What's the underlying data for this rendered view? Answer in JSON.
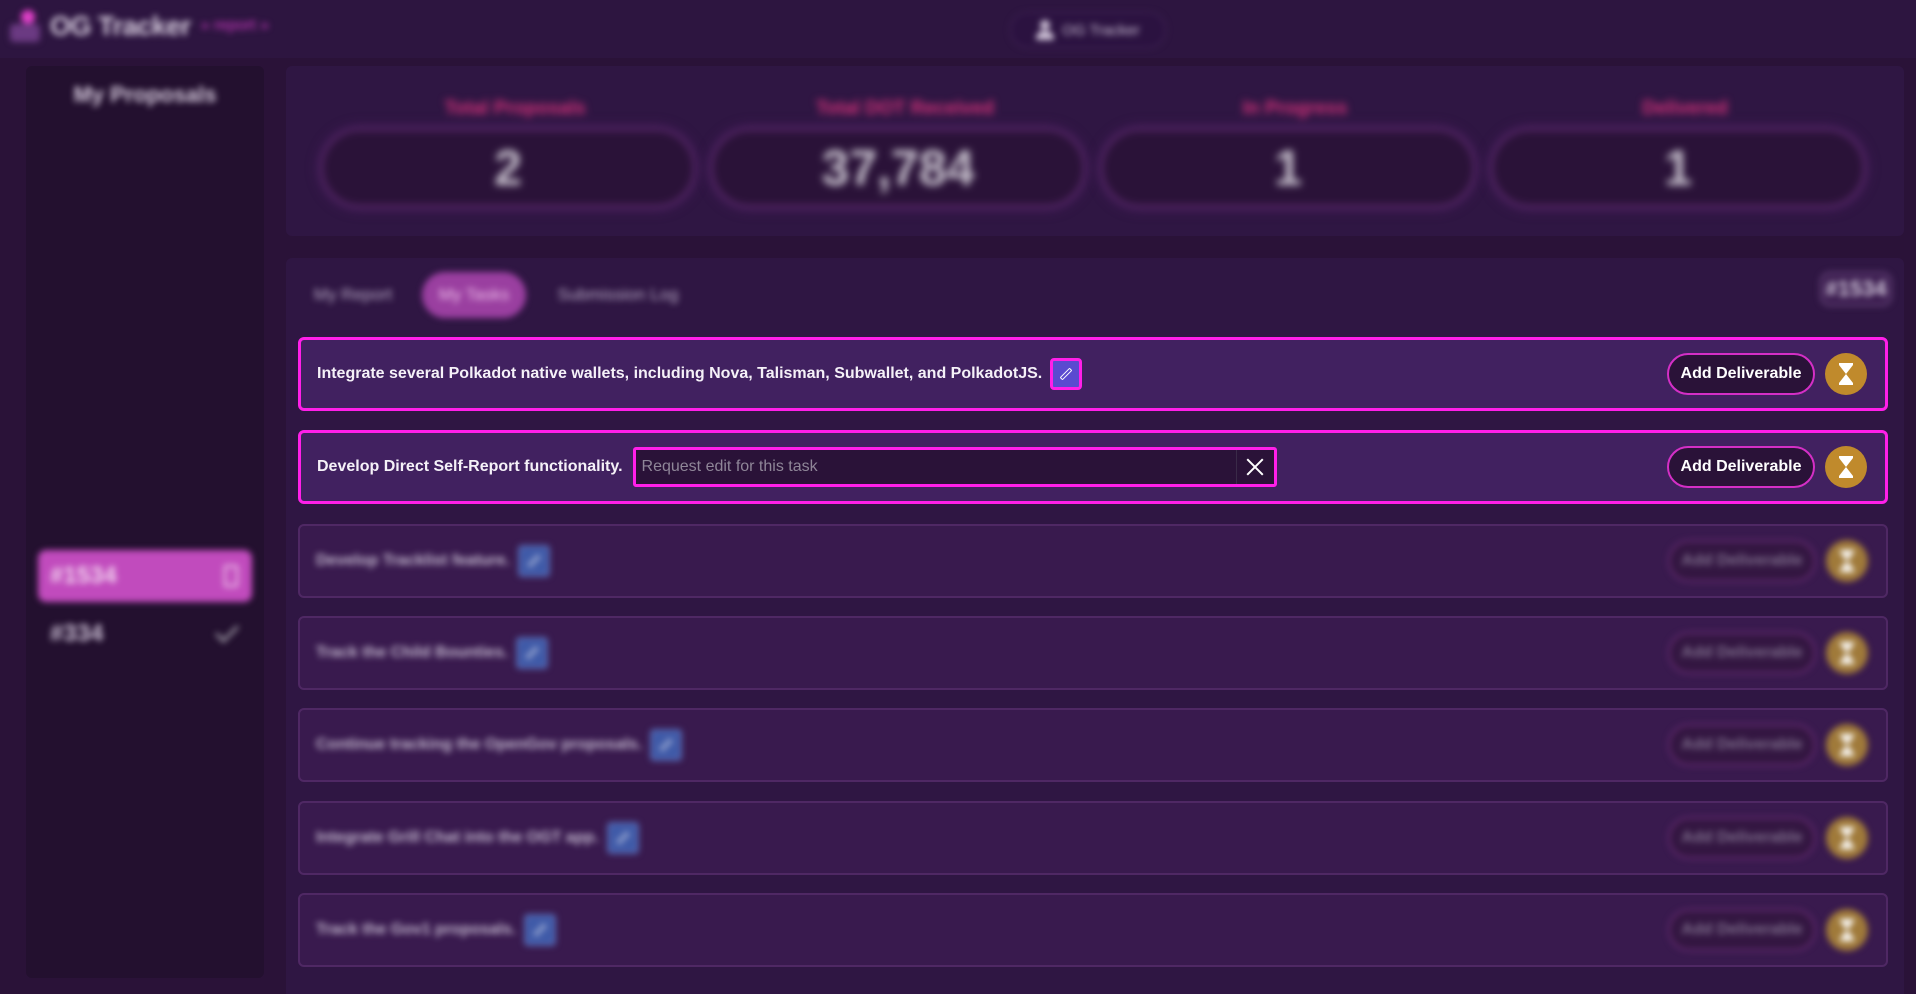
{
  "header": {
    "app_title": "OG Tracker",
    "app_subtitle": "» report »",
    "user_label": "OG Tracker"
  },
  "sidebar": {
    "title": "My Proposals",
    "proposals": [
      {
        "id": "#1534",
        "state": "selected"
      },
      {
        "id": "#334",
        "state": "done"
      }
    ]
  },
  "stats": [
    {
      "label": "Total Proposals",
      "value": "2"
    },
    {
      "label": "Total DOT Received",
      "value": "37,784"
    },
    {
      "label": "In Progress",
      "value": "1"
    },
    {
      "label": "Delivered",
      "value": "1"
    }
  ],
  "tabs": {
    "report": "My Report",
    "tasks": "My Tasks",
    "log": "Submission Log",
    "active": "tasks"
  },
  "proposal_id": "#1534",
  "tasks": [
    {
      "text": "Integrate several Polkadot native wallets, including Nova, Talisman, Subwallet, and PolkadotJS.",
      "add_label": "Add Deliverable"
    },
    {
      "text": "Develop Direct Self-Report functionality.",
      "add_label": "Add Deliverable"
    },
    {
      "text": "Develop Tracklist feature.",
      "add_label": "Add Deliverable"
    },
    {
      "text": "Track the Child Bounties.",
      "add_label": "Add Deliverable"
    },
    {
      "text": "Continue tracking the OpenGov proposals.",
      "add_label": "Add Deliverable"
    },
    {
      "text": "Integrate Grill Chat into the OGT app.",
      "add_label": "Add Deliverable"
    },
    {
      "text": "Track the Gov1 proposals.",
      "add_label": "Add Deliverable"
    }
  ],
  "request_edit": {
    "placeholder": "Request edit for this task",
    "value": ""
  },
  "colors": {
    "accent": "#ff1fe9",
    "background": "#2a1238",
    "status": "#c08a2c"
  }
}
